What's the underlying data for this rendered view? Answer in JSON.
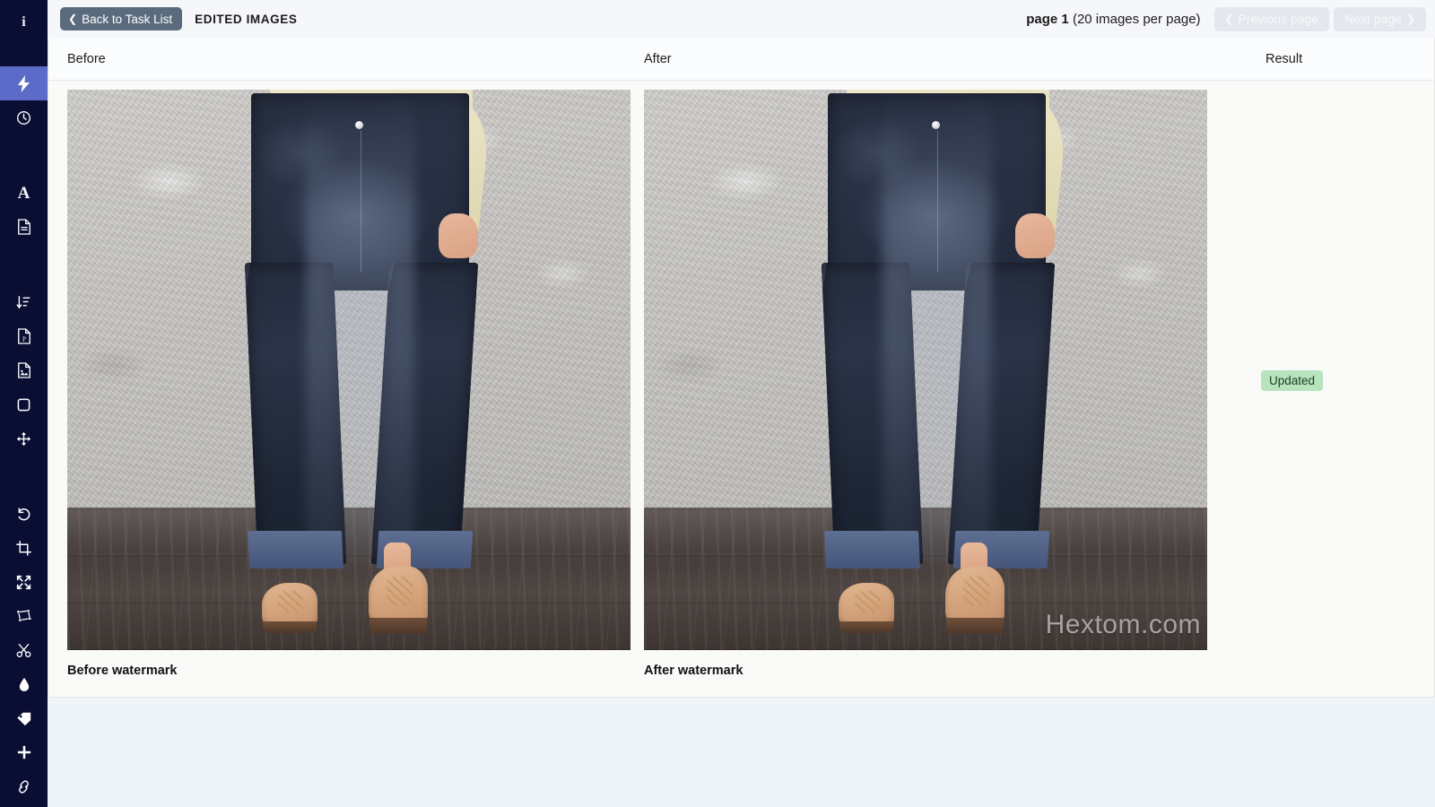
{
  "sidebar": {
    "items": [
      {
        "name": "info-icon",
        "label": "Info",
        "icon": "info",
        "active": false
      },
      {
        "name": "lightning-icon",
        "label": "Quick Action",
        "icon": "bolt",
        "active": true
      },
      {
        "name": "clock-icon",
        "label": "History",
        "icon": "clock",
        "active": false
      },
      {
        "name": "text-icon",
        "label": "Text",
        "icon": "letter-a",
        "active": false
      },
      {
        "name": "document-icon",
        "label": "Document",
        "icon": "document",
        "active": false
      },
      {
        "name": "sort-icon",
        "label": "Sort",
        "icon": "sort-descending",
        "active": false
      },
      {
        "name": "pdf-file-icon",
        "label": "PDF File",
        "icon": "file-pdf",
        "active": false
      },
      {
        "name": "image-file-icon",
        "label": "Image File",
        "icon": "file-image",
        "active": false
      },
      {
        "name": "square-icon",
        "label": "Shape",
        "icon": "square",
        "active": false
      },
      {
        "name": "move-icon",
        "label": "Move",
        "icon": "arrows-move",
        "active": false
      },
      {
        "name": "undo-icon",
        "label": "Undo",
        "icon": "undo",
        "active": false
      },
      {
        "name": "crop-icon",
        "label": "Crop",
        "icon": "crop",
        "active": false
      },
      {
        "name": "expand-icon",
        "label": "Expand",
        "icon": "expand-arrows",
        "active": false
      },
      {
        "name": "transform-icon",
        "label": "Transform",
        "icon": "transform",
        "active": false
      },
      {
        "name": "scissors-icon",
        "label": "Cut",
        "icon": "scissors",
        "active": false
      },
      {
        "name": "droplet-icon",
        "label": "Water",
        "icon": "droplet",
        "active": false
      },
      {
        "name": "tag-icon",
        "label": "Tag",
        "icon": "tag",
        "active": false
      },
      {
        "name": "plus-icon",
        "label": "Add",
        "icon": "plus",
        "active": false
      },
      {
        "name": "link-icon",
        "label": "Link",
        "icon": "link",
        "active": false
      }
    ]
  },
  "topbar": {
    "back_label": "Back to Task List",
    "back_chevron": "❮",
    "title": "EDITED IMAGES",
    "page_text": "page 1",
    "page_suffix": " (20 images per page)",
    "previous_label": "Previous page",
    "next_label": "Next page",
    "previous_chevron": "❮",
    "next_chevron": "❯"
  },
  "table": {
    "columns": {
      "before": "Before",
      "after": "After",
      "result": "Result"
    },
    "row": {
      "before_caption": "Before watermark",
      "after_caption": "After watermark",
      "result_badge": "Updated",
      "watermark_text": "Hextom.com"
    }
  },
  "colors": {
    "sidebar_bg": "#0b0e33",
    "sidebar_active": "#5c6bc8",
    "back_button": "#5a6b7d",
    "badge_bg": "#b7e4bd",
    "page_bg": "#eff4f8",
    "card_bg": "#fafaf8"
  }
}
